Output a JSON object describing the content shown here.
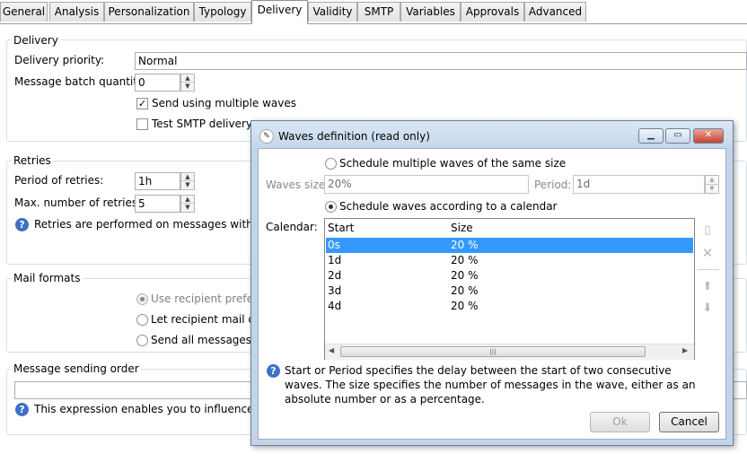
{
  "tabs": [
    "General",
    "Analysis",
    "Personalization",
    "Typology",
    "Delivery",
    "Validity",
    "SMTP",
    "Variables",
    "Approvals",
    "Advanced"
  ],
  "active_tab": "Delivery",
  "delivery": {
    "group_title": "Delivery",
    "priority_label": "Delivery priority:",
    "priority_value": "Normal",
    "batch_label": "Message batch quantity:",
    "batch_value": "0",
    "multiple_waves_label": "Send using multiple waves",
    "multiple_waves_checked": true,
    "test_smtp_label": "Test SMTP delivery",
    "test_smtp_checked": false
  },
  "retries": {
    "group_title": "Retries",
    "period_label": "Period of retries:",
    "period_value": "1h",
    "max_label": "Max. number of retries:",
    "max_value": "5",
    "info": "Retries are performed on messages with errors"
  },
  "mail_formats": {
    "group_title": "Mail formats",
    "options": [
      "Use recipient preferen",
      "Let recipient mail clie",
      "Send all messages in"
    ]
  },
  "sending_order": {
    "group_title": "Message sending order",
    "expression_value": "",
    "info": "This expression enables you to influence the o"
  },
  "dialog": {
    "title": "Waves definition (read only)",
    "icon": "adobe-campaign-icon",
    "minimize_icon": "minimize-icon",
    "maximize_icon": "maximize-icon",
    "close_icon": "close-icon",
    "opt_same_size": "Schedule multiple waves of the same size",
    "waves_size_label": "Waves size:",
    "waves_size_value": "20%",
    "period_label": "Period:",
    "period_value": "1d",
    "opt_calendar": "Schedule waves according to a calendar",
    "calendar_label": "Calendar:",
    "columns": [
      "Start",
      "Size"
    ],
    "rows": [
      {
        "start": "0s",
        "size": "20 %"
      },
      {
        "start": "1d",
        "size": "20 %"
      },
      {
        "start": "2d",
        "size": "20 %"
      },
      {
        "start": "3d",
        "size": "20 %"
      },
      {
        "start": "4d",
        "size": "20 %"
      }
    ],
    "selected_row": 0,
    "help_text": "Start or Period specifies the delay between the start of two consecutive waves. The size specifies the number of messages in the wave, either as an absolute number or as a percentage.",
    "ok_label": "Ok",
    "cancel_label": "Cancel"
  },
  "colors": {
    "selection": "#3399ff",
    "dialog_frame": "#c3d4ea",
    "info_icon": "#3e70c4"
  }
}
